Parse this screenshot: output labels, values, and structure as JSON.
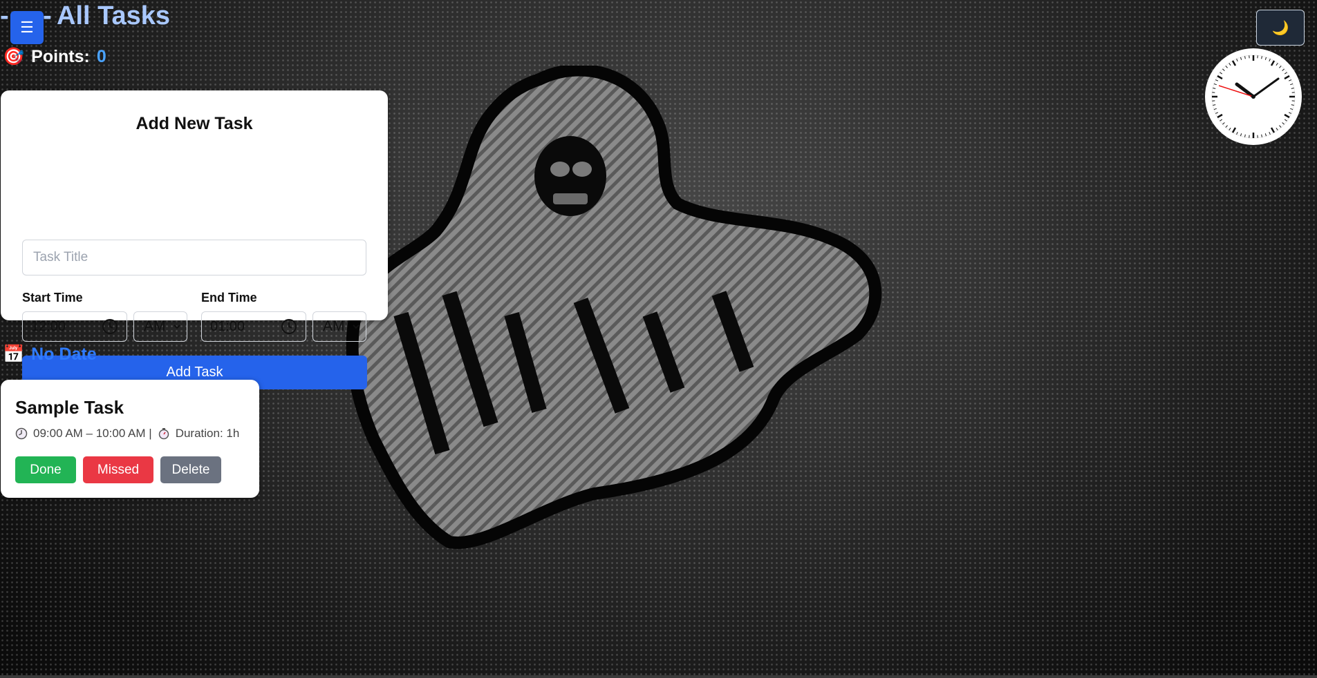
{
  "header": {
    "title": "All Tasks",
    "menu_icon": "☰",
    "theme_icon": "🌙"
  },
  "points": {
    "label": "Points:",
    "value": "0",
    "icon": "🎯"
  },
  "add_task": {
    "heading": "Add New Task",
    "title_placeholder": "Task Title",
    "start_label": "Start Time",
    "start_value": "12:00",
    "start_period": "AM",
    "end_label": "End Time",
    "end_value": "01:00",
    "end_period": "AM",
    "submit_label": "Add Task"
  },
  "section": {
    "icon": "📅",
    "label": "No Date"
  },
  "tasks": [
    {
      "title": "Sample Task",
      "time_range": "09:00 AM – 10:00 AM |",
      "duration": "Duration: 1h",
      "done_label": "Done",
      "missed_label": "Missed",
      "delete_label": "Delete"
    }
  ],
  "colors": {
    "accent": "#2563eb",
    "done": "#22b455",
    "missed": "#ea3844",
    "delete": "#6b7280",
    "points_value": "#4aa3ff",
    "section_label": "#2f7bff"
  }
}
